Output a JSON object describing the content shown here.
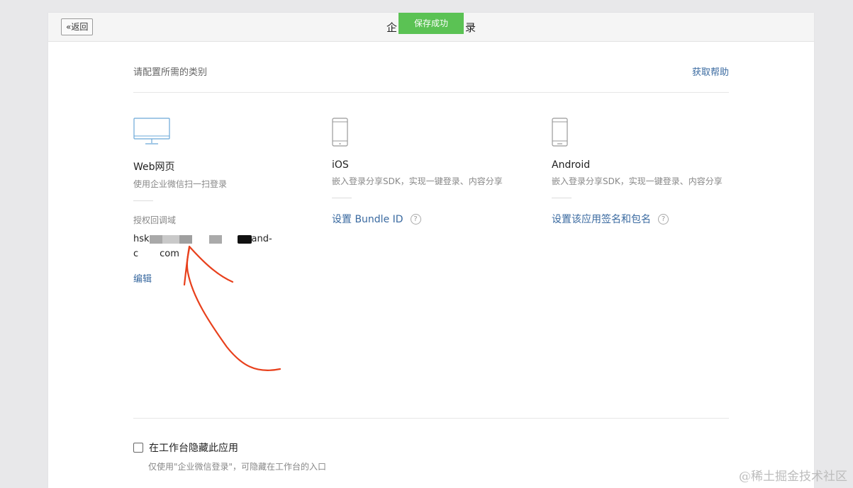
{
  "header": {
    "back_label": "返回",
    "title_left": "企",
    "title_right": "录"
  },
  "toast": {
    "text": "保存成功",
    "color": "#5bc254"
  },
  "section": {
    "label": "请配置所需的类别",
    "help_link": "获取帮助"
  },
  "categories": [
    {
      "name": "Web网页",
      "icon": "monitor-icon",
      "desc": "使用企业微信扫一扫登录",
      "domain_label": "授权回调域",
      "domain_prefix": "hsk",
      "domain_mid": "and-",
      "domain_line2_prefix": "c",
      "domain_line2_suffix": "com",
      "edit_label": "编辑"
    },
    {
      "name": "iOS",
      "icon": "phone-icon",
      "desc": "嵌入登录分享SDK，实现一键登录、内容分享",
      "action": "设置 Bundle ID"
    },
    {
      "name": "Android",
      "icon": "phone-icon",
      "desc": "嵌入登录分享SDK，实现一键登录、内容分享",
      "action": "设置该应用签名和包名"
    }
  ],
  "hide_option": {
    "label": "在工作台隐藏此应用",
    "checked": false,
    "hint": "仅使用\"企业微信登录\"，可隐藏在工作台的入口"
  },
  "help_icon_glyph": "?",
  "watermark": "@稀土掘金技术社区",
  "colors": {
    "link": "#3a6aa0",
    "annotation_arrow": "#e8401c",
    "page_bg": "#e8e8ea"
  }
}
